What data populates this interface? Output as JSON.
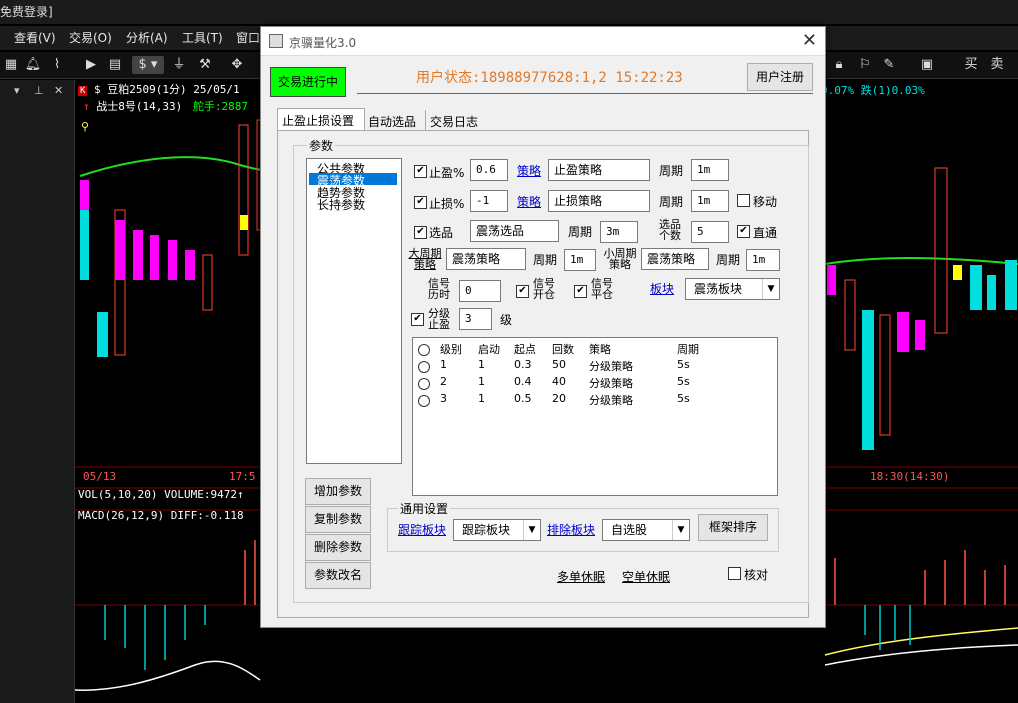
{
  "app": {
    "title_fragment": "免费登录]",
    "menus": [
      "查看(V)",
      "交易(O)",
      "分析(A)",
      "工具(T)",
      "窗口"
    ],
    "toolbar_right": [
      "买",
      "卖"
    ]
  },
  "chart": {
    "symbol_line": "$ 豆粕2509(1分) 25/05/1",
    "indicator_line": "战士8号(14,33)",
    "indicator_extra": "舵手:2887",
    "right_stats": "0.07% 跌(1)0.03%",
    "date_left": "05/13",
    "time_left": "17:5",
    "time_right": "18:30(14:30)",
    "vol_line": "VOL(5,10,20) VOLUME:9472↑",
    "macd_line": "MACD(26,12,9) DIFF:-0.118"
  },
  "dialog": {
    "title": "京骥量化3.0",
    "trade_status_btn": "交易进行中",
    "user_status": "用户状态:18988977628:1,2 15:22:23",
    "register_btn": "用户注册",
    "tabs": [
      "止盈止损设置",
      "自动选品",
      "交易日志"
    ],
    "params_group": "参数",
    "param_list": [
      "公共参数",
      "震荡参数",
      "趋势参数",
      "长持参数"
    ],
    "take_profit": {
      "label": "止盈%",
      "value": "0.6",
      "strategy_link": "策略",
      "strategy": "止盈策略",
      "period_label": "周期",
      "period": "1m"
    },
    "stop_loss": {
      "label": "止损%",
      "value": "-1",
      "strategy_link": "策略",
      "strategy": "止损策略",
      "period_label": "周期",
      "period": "1m",
      "move_label": "移动"
    },
    "select": {
      "label": "选品",
      "value": "震荡选品",
      "period_label": "周期",
      "period": "3m",
      "count_label_1": "选品",
      "count_label_2": "个数",
      "count": "5",
      "direct_label": "直通"
    },
    "big_period": {
      "label_1": "大周期",
      "label_2": "策略",
      "value": "震荡策略",
      "period_label": "周期",
      "period": "1m"
    },
    "small_period": {
      "label_1": "小周期",
      "label_2": "策略",
      "value": "震荡策略",
      "period_label": "周期",
      "period": "1m"
    },
    "signal_open": {
      "label_1": "信号",
      "label_2": "历时",
      "value": "0"
    },
    "signal_kaicang": {
      "label_1": "信号",
      "label_2": "开仓"
    },
    "signal_pingcang": {
      "label_1": "信号",
      "label_2": "平仓"
    },
    "sector_link": "板块",
    "sector_value": "震荡板块",
    "grade_stop": {
      "label_1": "分级",
      "label_2": "止盈",
      "value": "3",
      "unit": "级"
    },
    "table": {
      "headers": [
        "级别",
        "启动",
        "起点",
        "回数",
        "策略",
        "周期"
      ],
      "rows": [
        [
          "1",
          "1",
          "0.3",
          "50",
          "分级策略",
          "5s"
        ],
        [
          "2",
          "1",
          "0.4",
          "40",
          "分级策略",
          "5s"
        ],
        [
          "3",
          "1",
          "0.5",
          "20",
          "分级策略",
          "5s"
        ]
      ]
    },
    "buttons_left": [
      "增加参数",
      "复制参数",
      "删除参数",
      "参数改名"
    ],
    "general": {
      "title": "通用设置",
      "track_link": "跟踪板块",
      "track_value": "跟踪板块",
      "exclude_link": "排除板块",
      "exclude_value": "自选股",
      "frame_sort_btn": "框架排序"
    },
    "bottom": {
      "multi_rest": "多单休眠",
      "short_rest": "空单休眠",
      "verify": "核对"
    }
  },
  "colors": {
    "status_green": "#00ff00",
    "user_status": "#e07a2a",
    "link": "#0000cc",
    "cyan": "#00e0e0",
    "magenta": "#ff00ff"
  }
}
